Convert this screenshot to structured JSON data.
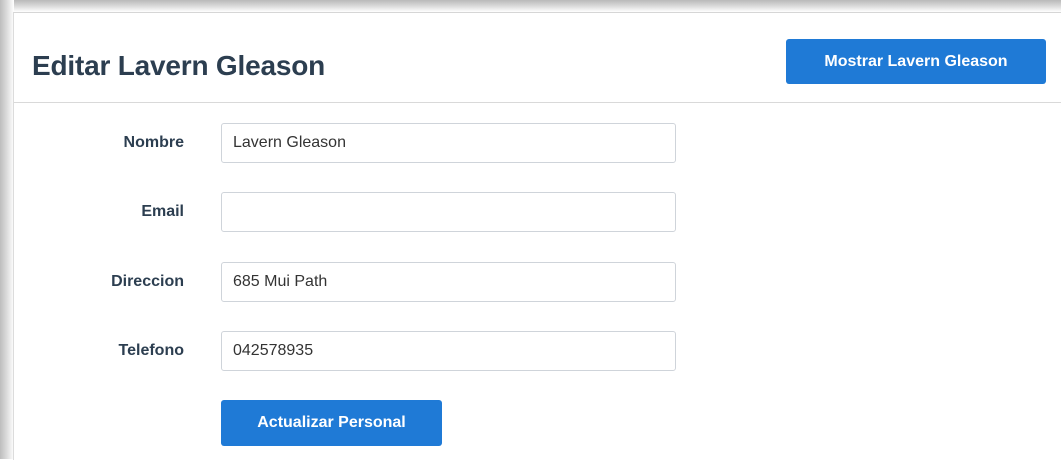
{
  "header": {
    "title": "Editar Lavern Gleason",
    "show_button_label": "Mostrar Lavern Gleason"
  },
  "form": {
    "fields": [
      {
        "label": "Nombre",
        "value": "Lavern Gleason",
        "placeholder": ""
      },
      {
        "label": "Email",
        "value": "",
        "placeholder": ""
      },
      {
        "label": "Direccion",
        "value": "685 Mui Path",
        "placeholder": ""
      },
      {
        "label": "Telefono",
        "value": "042578935",
        "placeholder": ""
      }
    ],
    "submit_label": "Actualizar Personal"
  },
  "colors": {
    "primary_button": "#1f7ad6",
    "heading_text": "#2c3e50",
    "input_border": "#cfd4da"
  }
}
